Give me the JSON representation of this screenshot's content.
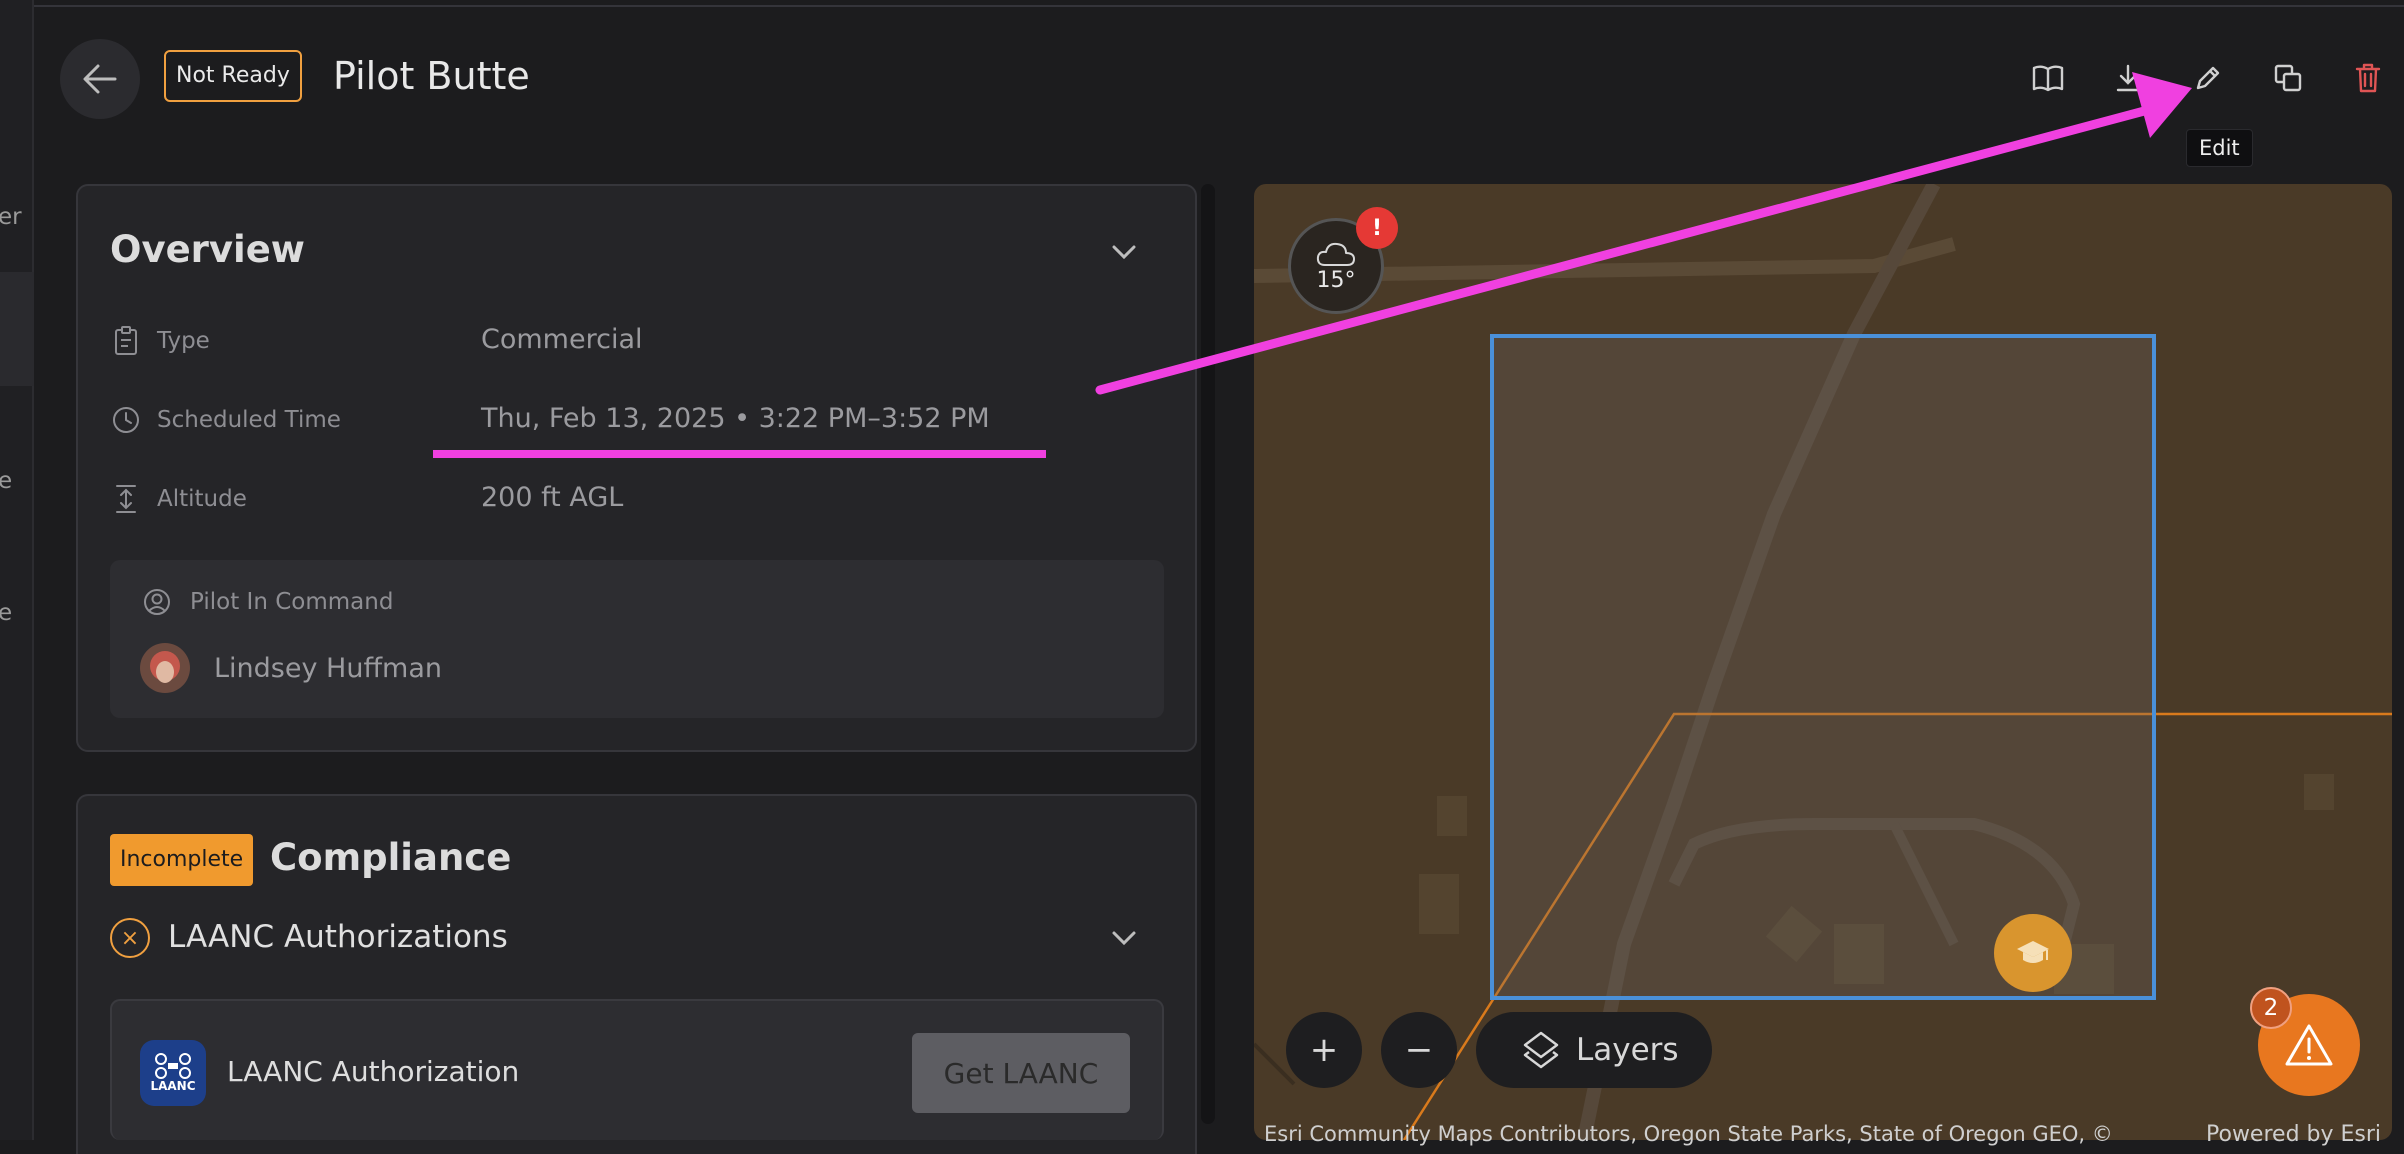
{
  "sidebar": {
    "fragments": [
      "er",
      "e",
      "e"
    ]
  },
  "header": {
    "status": "Not Ready",
    "title": "Pilot Butte",
    "tooltip": "Edit"
  },
  "overview": {
    "title": "Overview",
    "rows": [
      {
        "label": "Type",
        "value": "Commercial",
        "icon": "clipboard-icon"
      },
      {
        "label": "Scheduled Time",
        "value": "Thu, Feb 13, 2025 • 3:22 PM–3:52 PM",
        "icon": "clock-icon"
      },
      {
        "label": "Altitude",
        "value": "200 ft AGL",
        "icon": "altitude-icon"
      }
    ],
    "pilot_label": "Pilot In Command",
    "pilot_name": "Lindsey Huffman"
  },
  "compliance": {
    "badge": "Incomplete",
    "title": "Compliance",
    "laanc_section": "LAANC Authorizations",
    "laanc_item": "LAANC Authorization",
    "laanc_logo": "LAANC",
    "get_button": "Get LAANC"
  },
  "map": {
    "temperature": "15°",
    "weather_alert": "!",
    "zoom_in": "+",
    "zoom_out": "−",
    "layers": "Layers",
    "attribution": "Esri Community Maps Contributors, Oregon State Parks, State of Oregon GEO, ©",
    "powered": "Powered by Esri",
    "alerts_count": "2"
  },
  "colors": {
    "accent_orange": "#f0a040",
    "annotation_magenta": "#f040e0",
    "flight_area_blue": "#4a90d9",
    "delete_red": "#e05555"
  }
}
